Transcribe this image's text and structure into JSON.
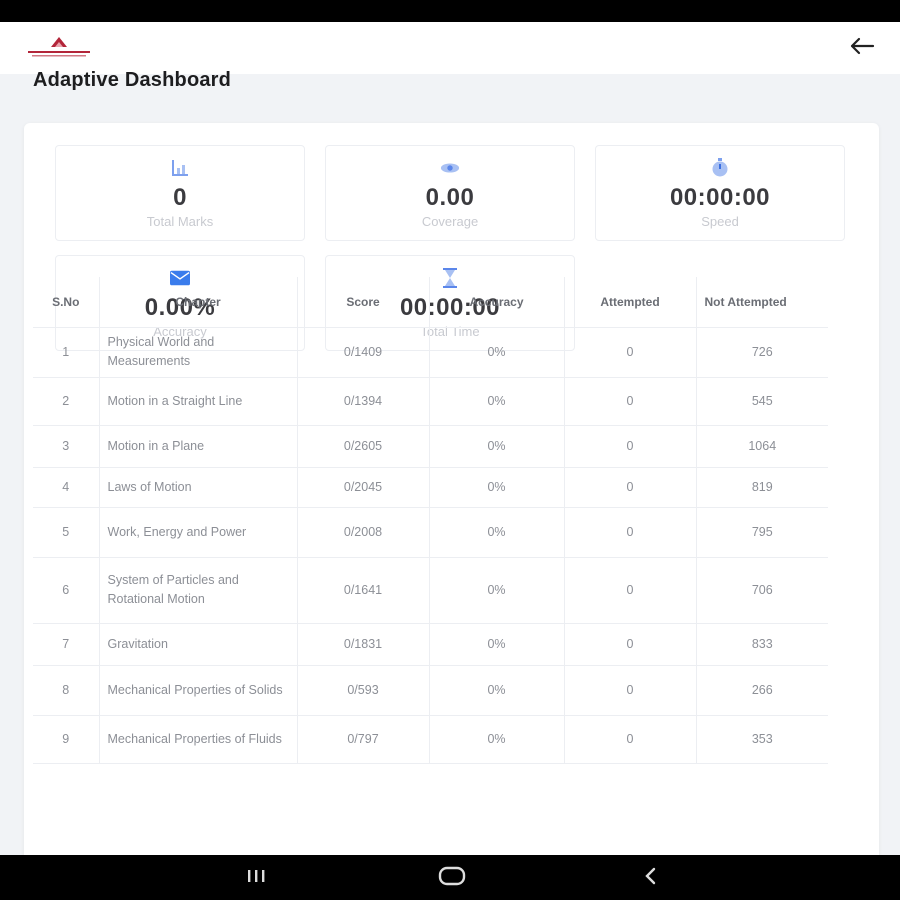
{
  "page": {
    "title": "Adaptive Dashboard"
  },
  "header": {
    "back_icon": "arrow-left-icon",
    "logo_icon": "brand-logo"
  },
  "stats": [
    {
      "value": "0",
      "label": "Total Marks",
      "icon": "bar-chart-icon",
      "color": "#7da0ee"
    },
    {
      "value": "0.00",
      "label": "Coverage",
      "icon": "eye-icon",
      "color": "#7da0ee"
    },
    {
      "value": "00:00:00",
      "label": "Speed",
      "icon": "stopwatch-icon",
      "color": "#7da0ee"
    },
    {
      "value": "0.00%",
      "label": "Accuracy",
      "icon": "envelope-icon",
      "color": "#3a7cec"
    },
    {
      "value": "00:00:00",
      "label": "Total Time",
      "icon": "hourglass-icon",
      "color": "#7da0ee"
    }
  ],
  "table": {
    "headers": [
      "S.No",
      "Chapter",
      "Score",
      "Accuracy",
      "Attempted",
      "Not Attempted"
    ],
    "rows": [
      {
        "sno": "1",
        "chapter": "Physical World and Measurements",
        "score": "0/1409",
        "accuracy": "0%",
        "attempted": "0",
        "not_attempted": "726"
      },
      {
        "sno": "2",
        "chapter": "Motion in a Straight Line",
        "score": "0/1394",
        "accuracy": "0%",
        "attempted": "0",
        "not_attempted": "545"
      },
      {
        "sno": "3",
        "chapter": "Motion in a Plane",
        "score": "0/2605",
        "accuracy": "0%",
        "attempted": "0",
        "not_attempted": "1064"
      },
      {
        "sno": "4",
        "chapter": "Laws of Motion",
        "score": "0/2045",
        "accuracy": "0%",
        "attempted": "0",
        "not_attempted": "819"
      },
      {
        "sno": "5",
        "chapter": "Work, Energy and Power",
        "score": "0/2008",
        "accuracy": "0%",
        "attempted": "0",
        "not_attempted": "795"
      },
      {
        "sno": "6",
        "chapter": "System of Particles and Rotational Motion",
        "score": "0/1641",
        "accuracy": "0%",
        "attempted": "0",
        "not_attempted": "706"
      },
      {
        "sno": "7",
        "chapter": "Gravitation",
        "score": "0/1831",
        "accuracy": "0%",
        "attempted": "0",
        "not_attempted": "833"
      },
      {
        "sno": "8",
        "chapter": "Mechanical Properties of Solids",
        "score": "0/593",
        "accuracy": "0%",
        "attempted": "0",
        "not_attempted": "266"
      },
      {
        "sno": "9",
        "chapter": "Mechanical Properties of Fluids",
        "score": "0/797",
        "accuracy": "0%",
        "attempted": "0",
        "not_attempted": "353"
      }
    ]
  },
  "navbar": {
    "recents_icon": "recents-icon",
    "home_icon": "home-icon",
    "back_icon": "back-chevron-icon"
  },
  "colors": {
    "accent": "#3a7cec",
    "logo": "#b3263a"
  }
}
